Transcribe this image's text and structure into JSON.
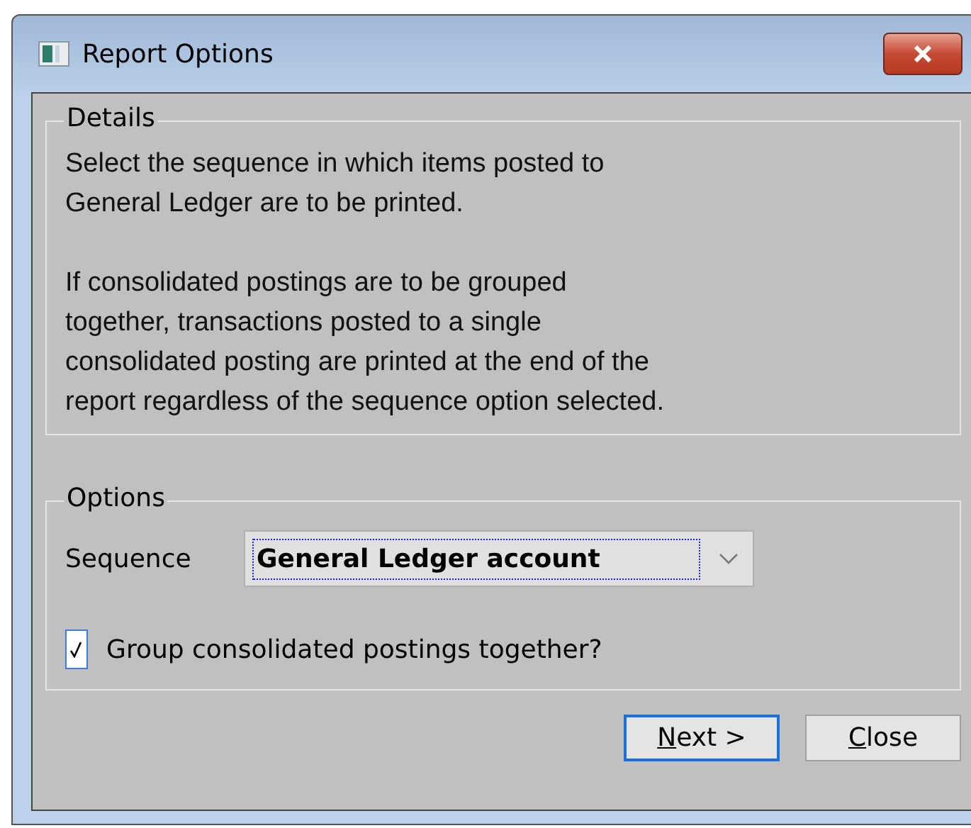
{
  "window": {
    "title": "Report Options"
  },
  "details": {
    "title": "Details",
    "paragraphs": [
      "Select the sequence in which items posted to General Ledger are to be printed.",
      "If consolidated postings are to be grouped together, transactions posted to a single consolidated posting are printed at the end of the report regardless of the sequence option selected."
    ]
  },
  "options": {
    "title": "Options",
    "sequence": {
      "label": "Sequence",
      "value": "General Ledger account",
      "focused": true
    },
    "group_checkbox": {
      "label": "Group consolidated postings together?",
      "checked": true
    }
  },
  "buttons": [
    {
      "label": "Next >",
      "default": true,
      "underline_first": true
    },
    {
      "label": "Close",
      "default": false,
      "underline_first": true
    }
  ]
}
